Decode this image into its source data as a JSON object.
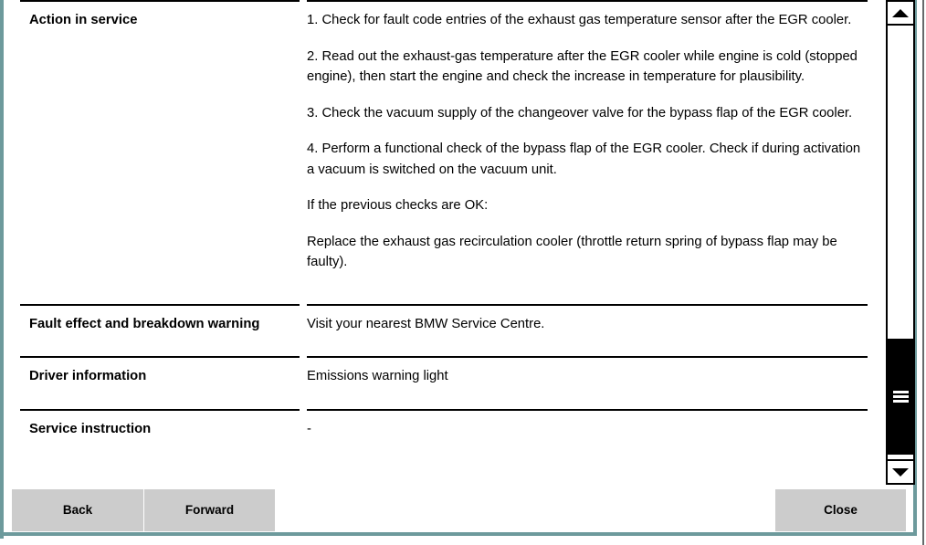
{
  "window": {
    "frame_color": "#6d9a9c",
    "panel_background": "#ffffff",
    "button_face": "#cccccc"
  },
  "document": {
    "rows": [
      {
        "label": "Action in service",
        "paragraphs": [
          "1. Check for fault code entries of the exhaust gas temperature sensor after the EGR cooler.",
          "2. Read out the exhaust-gas temperature after the EGR cooler while engine is cold (stopped engine), then start the engine and check the increase in temperature for plausibility.",
          "3. Check the vacuum supply of the changeover valve for the bypass flap of the EGR cooler.",
          "4. Perform a functional check of the bypass flap of the EGR cooler. Check if during activation a vacuum is switched on the vacuum unit.",
          "If the previous checks are OK:",
          "Replace the exhaust gas recirculation cooler (throttle return spring of bypass flap may be faulty)."
        ]
      },
      {
        "label": "Fault effect and breakdown warning",
        "paragraphs": [
          "Visit your nearest BMW Service Centre."
        ]
      },
      {
        "label": "Driver information",
        "paragraphs": [
          "Emissions warning light"
        ]
      },
      {
        "label": "Service instruction",
        "paragraphs": [
          "-"
        ]
      }
    ]
  },
  "scrollbar": {
    "up_icon": "triangle-up-icon",
    "down_icon": "triangle-down-icon",
    "grip_icon": "grip-lines-icon",
    "thumb_color": "#000000",
    "track_color": "#ffffff"
  },
  "buttons": {
    "back": "Back",
    "forward": "Forward",
    "close": "Close"
  }
}
